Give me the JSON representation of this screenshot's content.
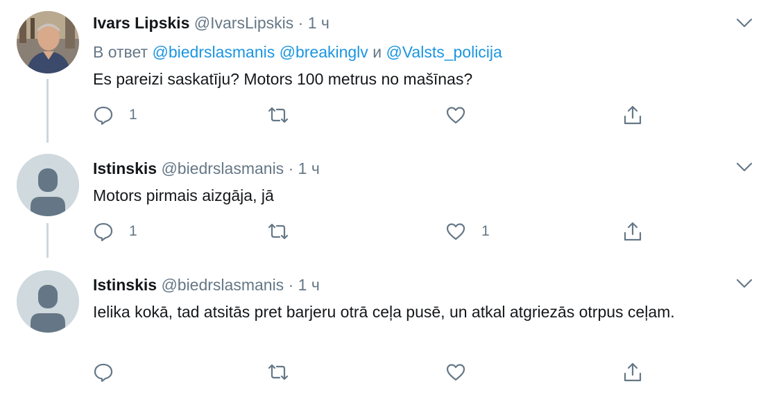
{
  "tweets": [
    {
      "name": "Ivars Lipskis",
      "handle": "@IvarsLipskis",
      "dot": "·",
      "time": "1 ч",
      "reply_prefix": "В ответ",
      "mention1": "@biedrslasmanis",
      "mention2": "@breakinglv",
      "conj": "и",
      "mention3": "@Valsts_policija",
      "text": "Es pareizi saskatīju? Motors 100 metrus no mašīnas?",
      "reply_count": "1",
      "like_count": ""
    },
    {
      "name": "Istinskis",
      "handle": "@biedrslasmanis",
      "dot": "·",
      "time": "1 ч",
      "text": "Motors pirmais aizgāja, jā",
      "reply_count": "1",
      "like_count": "1"
    },
    {
      "name": "Istinskis",
      "handle": "@biedrslasmanis",
      "dot": "·",
      "time": "1 ч",
      "text": "Ielika kokā, tad atsitās pret barjeru otrā ceļa pusē, un atkal atgriezās otrpus ceļam.",
      "reply_count": "",
      "like_count": ""
    }
  ],
  "icons": {
    "reply": "reply-icon",
    "retweet": "retweet-icon",
    "like": "heart-icon",
    "share": "share-icon",
    "caret": "chevron-down-icon",
    "avatar_default": "default-avatar-icon"
  },
  "colors": {
    "secondary_text": "#657786",
    "link": "#1b95e0",
    "thread_line": "#ccd6dd",
    "default_avatar_bg": "#cfd9de"
  }
}
